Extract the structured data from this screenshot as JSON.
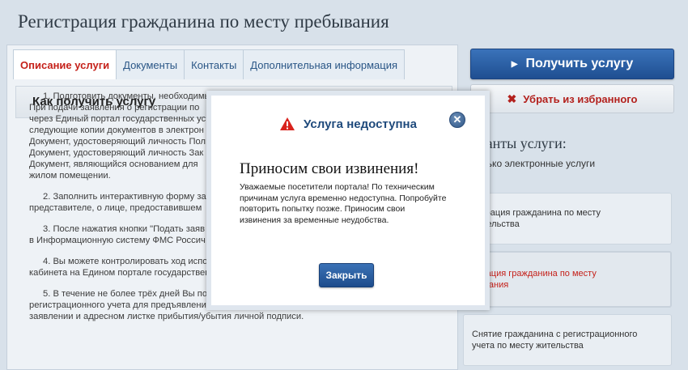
{
  "page": {
    "title": "Регистрация гражданина по месту пребывания"
  },
  "tabs": [
    {
      "label": "Описание услуги",
      "active": true
    },
    {
      "label": "Документы",
      "active": false
    },
    {
      "label": "Контакты",
      "active": false
    },
    {
      "label": "Дополнительная информация",
      "active": false
    }
  ],
  "content": {
    "heading": "Как получить услугу",
    "steps": [
      [
        "1. Подготовить документы, необходимы",
        "При подачи заявления о регистрации по",
        "через Единый портал государственных ус",
        "следующие копии документов в электрон",
        "Документ, удостоверяющий личность Пол",
        "Документ, удостоверяющий личность Зак",
        "Документ, являющийся основанием для",
        "жилом помещении."
      ],
      [
        "2. Заполнить интерактивную форму зая",
        "представителе, о лице, предоставившем"
      ],
      [
        "3. После нажатия кнопки \"Подать заяв",
        "в Информационную систему ФМС Россич"
      ],
      [
        "4. Вы можете контролировать ход испо",
        "кабинета на Едином портале государственных услуг."
      ],
      [
        "5. В течение не более трёх дней Вы получите приглашение в приемные часы прибыть в орган",
        "регистрационного учета для предъявления оригиналов документов и проставления в",
        "заявлении и адресном листке прибытия/убытия личной подписи."
      ]
    ]
  },
  "sidebar": {
    "get_service_label": "Получить услугу",
    "remove_favorite_label": "Убрать из избранного",
    "variants_title": "рианты услуги:",
    "variants_filter": "Только электронные услуги",
    "variants": [
      {
        "lines": [
          "истрация гражданина по месту",
          "жительства"
        ],
        "selected": false
      },
      {
        "lines": [
          "страция гражданина по месту",
          "бывания"
        ],
        "selected": true
      },
      {
        "lines": [
          "Снятие гражданина с регистрационного",
          "учета по месту жительства"
        ],
        "selected": false
      }
    ]
  },
  "modal": {
    "title": "Услуга недоступна",
    "apology": "Приносим свои извинения!",
    "message_lines": [
      "Уважаемые посетители портала! По техническим",
      "причинам услуга временно недоступна. Попробуйте",
      "повторить попытку позже. Приносим свои",
      "извинения за временные неудобства."
    ],
    "close_button_label": "Закрыть"
  },
  "colors": {
    "accent_blue": "#1f4f91",
    "active_tab_red": "#c5211a",
    "warning_red": "#d9231d"
  }
}
